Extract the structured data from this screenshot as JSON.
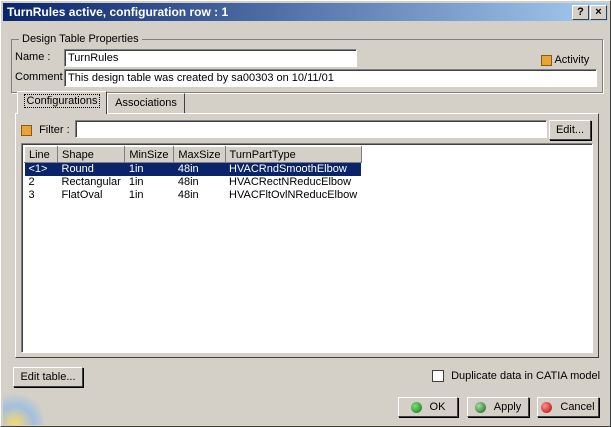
{
  "window": {
    "title": "TurnRules active, configuration row : 1",
    "help_btn": "?",
    "close_btn": "×"
  },
  "properties": {
    "legend": "Design Table Properties",
    "name_label": "Name :",
    "name_value": "TurnRules",
    "comment_label": "Comment :",
    "comment_value": "This design table was created by sa00303 on 10/11/01",
    "activity_label": "Activity"
  },
  "tabs": [
    {
      "label": "Configurations"
    },
    {
      "label": "Associations"
    }
  ],
  "filter": {
    "label": "Filter :",
    "value": "",
    "edit_label": "Edit..."
  },
  "table": {
    "headers": [
      "Line",
      "Shape",
      "MinSize",
      "MaxSize",
      "TurnPartType"
    ],
    "rows": [
      [
        "<1>",
        "Round",
        "1in",
        "48in",
        "HVACRndSmoothElbow"
      ],
      [
        "2",
        "Rectangular",
        "1in",
        "48in",
        "HVACRectNReducElbow"
      ],
      [
        "3",
        "FlatOval",
        "1in",
        "48in",
        "HVACFltOvlNReducElbow"
      ]
    ]
  },
  "footer": {
    "edit_table_label": "Edit table...",
    "duplicate_label": "Duplicate data in CATIA model",
    "ok_label": "OK",
    "apply_label": "Apply",
    "cancel_label": "Cancel"
  }
}
